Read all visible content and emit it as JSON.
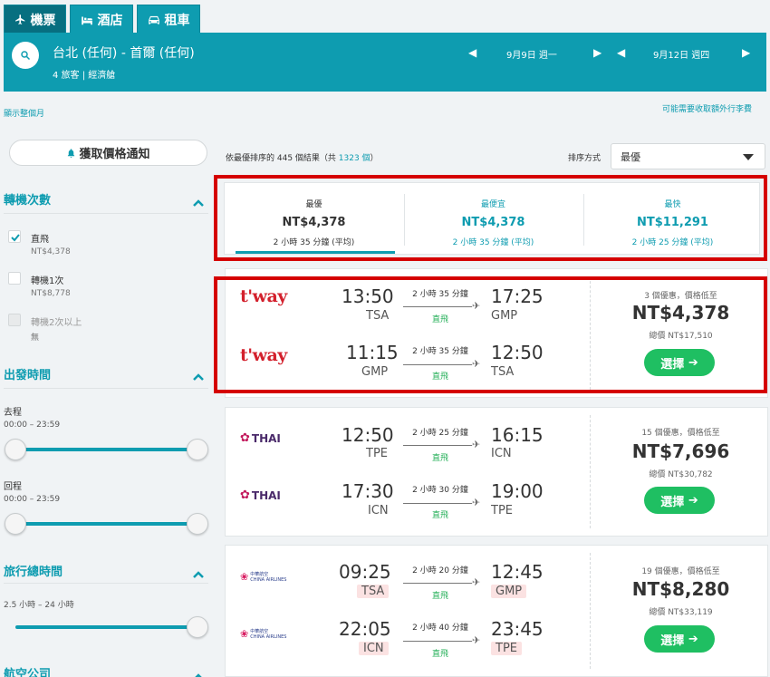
{
  "tabs": [
    {
      "label": "機票"
    },
    {
      "label": "酒店"
    },
    {
      "label": "租車"
    }
  ],
  "search": {
    "route": "台北 (任何) - 首爾 (任何)",
    "pax": "4 旅客",
    "cabin": "經濟艙",
    "depart_date": "9月9日 週一",
    "return_date": "9月12日 週四"
  },
  "links": {
    "show_month": "顯示整個月",
    "baggage_fee": "可能需要收取額外行李費"
  },
  "sidebar": {
    "price_alert": "獲取價格通知",
    "stops": {
      "title": "轉機次數",
      "options": [
        {
          "label": "直飛",
          "price": "NT$4,378",
          "checked": true
        },
        {
          "label": "轉機1次",
          "price": "NT$8,778",
          "checked": false
        },
        {
          "label": "轉機2次以上",
          "price": "無",
          "checked": false
        }
      ]
    },
    "departure": {
      "title": "出發時間",
      "outbound_label": "去程",
      "outbound_range": "00:00 – 23:59",
      "return_label": "回程",
      "return_range": "00:00 – 23:59"
    },
    "duration": {
      "title": "旅行總時間",
      "range": "2.5 小時 – 24 小時"
    },
    "airlines": {
      "title": "航空公司"
    }
  },
  "results": {
    "count_prefix": "依最優排序的 445 個結果（共 ",
    "count_link": "1323 個",
    "count_suffix": "）",
    "sort_label": "排序方式",
    "sort_value": "最優"
  },
  "sortbar": [
    {
      "title": "最優",
      "price": "NT$4,378",
      "duration": "2 小時 35 分鐘 (平均)"
    },
    {
      "title": "最便宜",
      "price": "NT$4,378",
      "duration": "2 小時 35 分鐘 (平均)"
    },
    {
      "title": "最快",
      "price": "NT$11,291",
      "duration": "2 小時 25 分鐘 (平均)"
    }
  ],
  "flights": [
    {
      "airline": "t'way",
      "deals": "3 個優惠，價格低至",
      "price": "NT$4,378",
      "total": "總價 NT$17,510",
      "select_label": "選擇",
      "legs": [
        {
          "dep": "13:50",
          "dep_ap": "TSA",
          "dur": "2 小時 35 分鐘",
          "stops": "直飛",
          "arr": "17:25",
          "arr_ap": "GMP"
        },
        {
          "dep": "11:15",
          "dep_ap": "GMP",
          "dur": "2 小時 35 分鐘",
          "stops": "直飛",
          "arr": "12:50",
          "arr_ap": "TSA"
        }
      ]
    },
    {
      "airline": "THAI",
      "deals": "15 個優惠，價格低至",
      "price": "NT$7,696",
      "total": "總價 NT$30,782",
      "select_label": "選擇",
      "legs": [
        {
          "dep": "12:50",
          "dep_ap": "TPE",
          "dur": "2 小時 25 分鐘",
          "stops": "直飛",
          "arr": "16:15",
          "arr_ap": "ICN"
        },
        {
          "dep": "17:30",
          "dep_ap": "ICN",
          "dur": "2 小時 30 分鐘",
          "stops": "直飛",
          "arr": "19:00",
          "arr_ap": "TPE"
        }
      ]
    },
    {
      "airline": "CHINA AIRLINES",
      "airline_cn": "中華航空",
      "deals": "19 個優惠，價格低至",
      "price": "NT$8,280",
      "total": "總價 NT$33,119",
      "select_label": "選擇",
      "legs": [
        {
          "dep": "09:25",
          "dep_ap": "TSA",
          "dur": "2 小時 20 分鐘",
          "stops": "直飛",
          "arr": "12:45",
          "arr_ap": "GMP"
        },
        {
          "dep": "22:05",
          "dep_ap": "ICN",
          "dur": "2 小時 40 分鐘",
          "stops": "直飛",
          "arr": "23:45",
          "arr_ap": "TPE"
        }
      ]
    }
  ],
  "colors": {
    "brand": "#0e9cb0",
    "select_green": "#1fbf62",
    "direct_green": "#27b05a",
    "highlight_red": "#d50000"
  }
}
